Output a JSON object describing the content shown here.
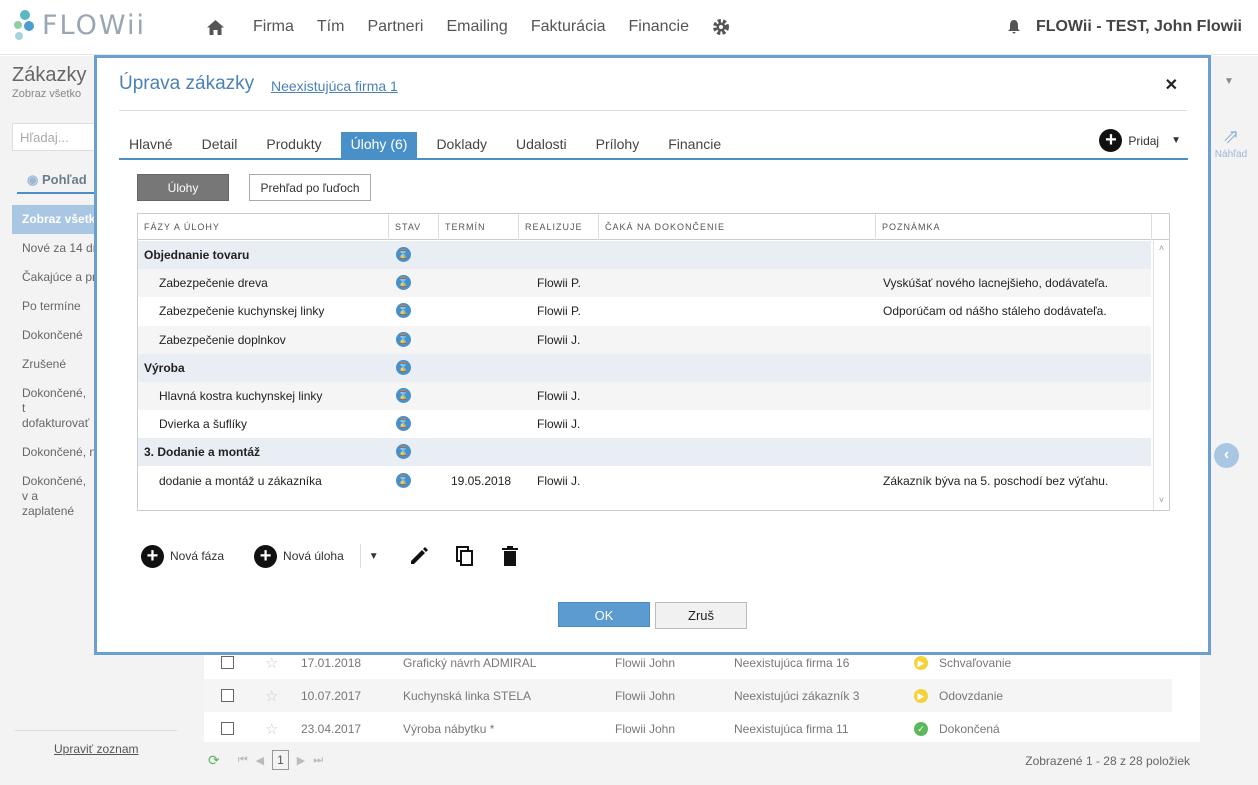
{
  "app": {
    "logo": "FLOWii"
  },
  "nav": {
    "items": [
      "Firma",
      "Tím",
      "Partneri",
      "Emailing",
      "Fakturácia",
      "Financie"
    ],
    "user": "FLOWii - TEST, John Flowii"
  },
  "sidebar": {
    "title": "Zákazky",
    "subtitle": "Zobraz všetko",
    "search_placeholder": "Hľadaj...",
    "view_label": "Pohľad",
    "items": [
      "Zobraz všetk",
      "Nové za 14 dn",
      "Čakajúce a pr",
      "Po termíne",
      "Dokončené",
      "Zrušené",
      "Dokončené, t dofakturovať",
      "Dokončené, n",
      "Dokončené, v a zaplatené"
    ],
    "edit_link": "Upraviť zoznam"
  },
  "background": {
    "preview_label": "Náhľad",
    "rows": [
      {
        "date": "17.01.2018",
        "name": "Grafický návrh ADMIRAL",
        "owner": "Flowii John",
        "client": "Neexistujúca firma 16",
        "status": "Schvaľovanie",
        "status_color": "#f3d23c"
      },
      {
        "date": "10.07.2017",
        "name": "Kuchynská linka STELA",
        "owner": "Flowii John",
        "client": "Neexistujúci zákazník 3",
        "status": "Odovzdanie",
        "status_color": "#f3d23c"
      },
      {
        "date": "23.04.2017",
        "name": "Výroba nábytku *",
        "owner": "Flowii John",
        "client": "Neexistujúca firma 11",
        "status": "Dokončená",
        "status_color": "#5cb85c"
      }
    ],
    "page": "1",
    "count_text": "Zobrazené 1 - 28 z 28 položiek"
  },
  "modal": {
    "title": "Úprava zákazky",
    "company_link": "Neexistujúca firma 1",
    "tabs": [
      "Hlavné",
      "Detail",
      "Produkty",
      "Úlohy (6)",
      "Doklady",
      "Udalosti",
      "Prílohy",
      "Financie"
    ],
    "add_label": "Pridaj",
    "segment_tasks": "Úlohy",
    "segment_people": "Prehľad po ľuďoch",
    "columns": [
      "FÁZY A ÚLOHY",
      "STAV",
      "TERMÍN",
      "REALIZUJE",
      "ČAKÁ NA DOKONČENIE",
      "POZNÁMKA"
    ],
    "rows": [
      {
        "kind": "phase",
        "name": "Objednanie tovaru",
        "date": "",
        "owner": "",
        "note": ""
      },
      {
        "kind": "task",
        "name": "Zabezpečenie dreva",
        "date": "",
        "owner": "Flowii P.",
        "note": "Vyskúšať nového lacnejšieho, dodávateľa."
      },
      {
        "kind": "task",
        "name": "Zabezpečenie kuchynskej linky",
        "date": "",
        "owner": "Flowii P.",
        "note": "Odporúčam od nášho stáleho dodávateľa."
      },
      {
        "kind": "task",
        "name": "Zabezpečenie doplnkov",
        "date": "",
        "owner": "Flowii J.",
        "note": ""
      },
      {
        "kind": "phase",
        "name": "Výroba",
        "date": "",
        "owner": "",
        "note": ""
      },
      {
        "kind": "task",
        "name": "Hlavná kostra kuchynskej linky",
        "date": "",
        "owner": "Flowii J.",
        "note": ""
      },
      {
        "kind": "task",
        "name": "Dvierka a šuflíky",
        "date": "",
        "owner": "Flowii J.",
        "note": ""
      },
      {
        "kind": "phase",
        "name": "3. Dodanie a montáž",
        "date": "",
        "owner": "",
        "note": ""
      },
      {
        "kind": "task",
        "name": "dodanie a montáž u zákazníka",
        "date": "19.05.2018",
        "owner": "Flowii J.",
        "note": "Zákazník býva na 5. poschodí bez výťahu."
      }
    ],
    "new_phase": "Nová fáza",
    "new_task": "Nová úloha",
    "ok": "OK",
    "cancel": "Zruš"
  }
}
